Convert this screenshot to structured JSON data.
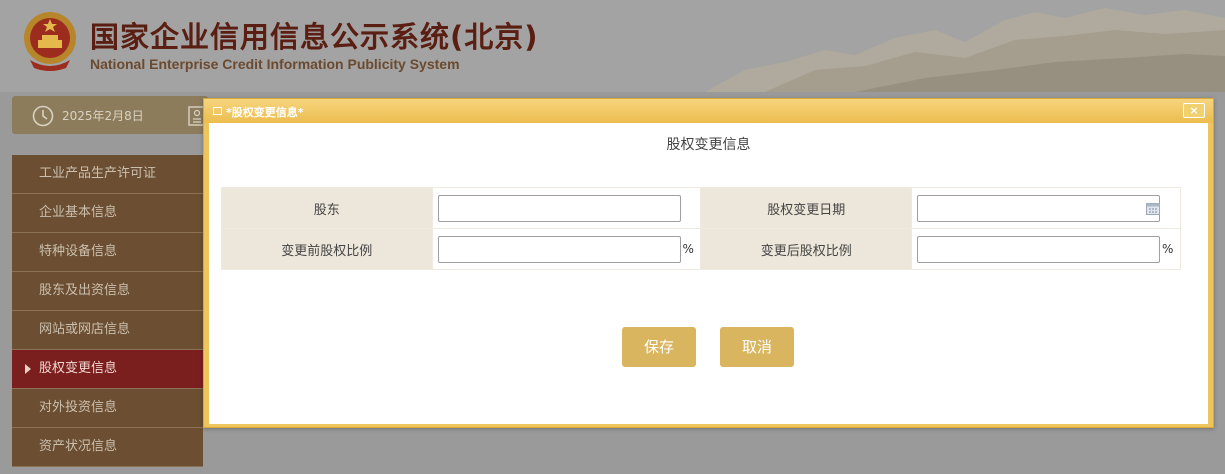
{
  "header": {
    "title": "国家企业信用信息公示系统(北京)",
    "title_en": "National Enterprise Credit Information Publicity System"
  },
  "datebar": {
    "date": "2025年2月8日",
    "clock_icon": "clock-icon",
    "doc_icon": "document-icon"
  },
  "sidebar": {
    "items": [
      {
        "label": "工业产品生产许可证",
        "active": false
      },
      {
        "label": "企业基本信息",
        "active": false
      },
      {
        "label": "特种设备信息",
        "active": false
      },
      {
        "label": "股东及出资信息",
        "active": false
      },
      {
        "label": "网站或网店信息",
        "active": false
      },
      {
        "label": "股权变更信息",
        "active": true
      },
      {
        "label": "对外投资信息",
        "active": false
      },
      {
        "label": "资产状况信息",
        "active": false
      }
    ]
  },
  "dialog": {
    "title": "*股权变更信息*",
    "close_label": "×",
    "heading": "股权变更信息",
    "fields": {
      "shareholder_label": "股东",
      "shareholder_value": "",
      "change_date_label": "股权变更日期",
      "change_date_value": "",
      "before_ratio_label": "变更前股权比例",
      "before_ratio_value": "",
      "after_ratio_label": "变更后股权比例",
      "after_ratio_value": "",
      "percent_unit": "%"
    },
    "save_label": "保存",
    "cancel_label": "取消"
  },
  "colors": {
    "dialog_frame": "#eec45c",
    "button": "#d8b55e",
    "sidebar_bg": "#6c4f32",
    "sidebar_active": "#7b1e1e",
    "label_cell": "#ede6da"
  }
}
